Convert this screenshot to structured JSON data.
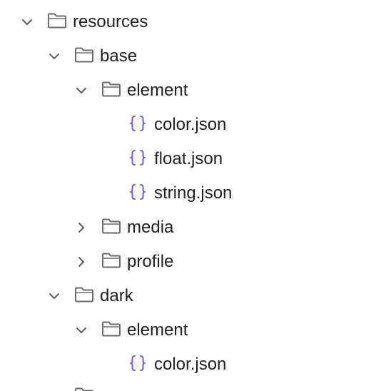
{
  "icons": {
    "expanded": "chevron-down-icon",
    "collapsed": "chevron-right-icon",
    "folder": "folder-icon",
    "json": "json-file-icon"
  },
  "colors": {
    "chevron": "#5b5b5b",
    "folder_stroke": "#6b6b6b",
    "json_icon": "#7b57e6",
    "text": "#1f1f1f"
  },
  "tree": {
    "resources": {
      "label": "resources",
      "expanded": true
    },
    "base": {
      "label": "base",
      "expanded": true
    },
    "base_element": {
      "label": "element",
      "expanded": true
    },
    "base_color": {
      "label": "color.json"
    },
    "base_float": {
      "label": "float.json"
    },
    "base_string": {
      "label": "string.json"
    },
    "base_media": {
      "label": "media",
      "expanded": false
    },
    "base_profile": {
      "label": "profile",
      "expanded": false
    },
    "dark": {
      "label": "dark",
      "expanded": true
    },
    "dark_element": {
      "label": "element",
      "expanded": true
    },
    "dark_color": {
      "label": "color.json"
    }
  }
}
